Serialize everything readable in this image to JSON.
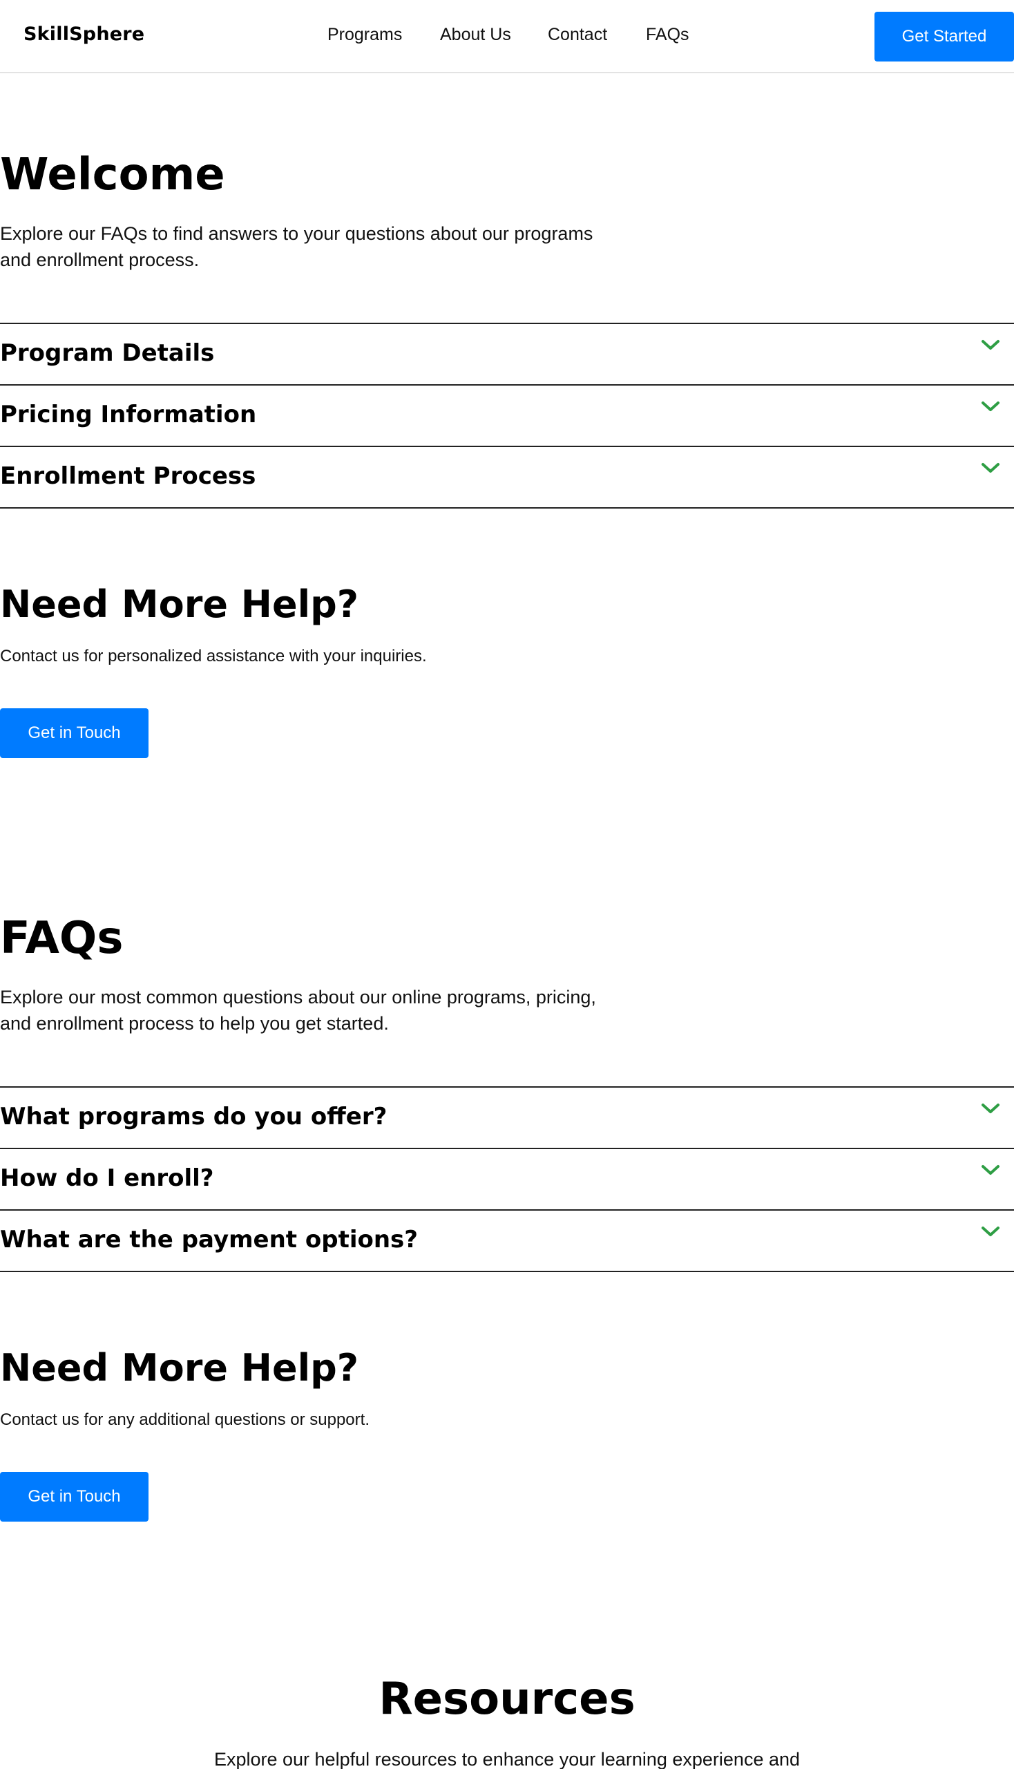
{
  "header": {
    "logo": "SkillSphere",
    "nav": [
      "Programs",
      "About Us",
      "Contact",
      "FAQs"
    ],
    "cta": "Get Started"
  },
  "welcome": {
    "title": "Welcome",
    "description_line1": "Explore our FAQs to find answers to your questions about our programs",
    "description_line2": "and enrollment process."
  },
  "accordion1": {
    "items": [
      "Program Details",
      "Pricing Information",
      "Enrollment Process"
    ],
    "chevron_icon": "chevron-down-icon",
    "chevron_color": "#2e9e44"
  },
  "help1": {
    "title": "Need More Help?",
    "description": "Contact us for personalized assistance with your inquiries.",
    "button": "Get in Touch"
  },
  "faqs": {
    "title": "FAQs",
    "description_line1": "Explore our most common questions about our online programs, pricing,",
    "description_line2": "and enrollment process to help you get started.",
    "items": [
      "What programs do you offer?",
      "How do I enroll?",
      "What are the payment options?"
    ]
  },
  "help2": {
    "title": "Need More Help?",
    "description": "Contact us for any additional questions or support.",
    "button": "Get in Touch"
  },
  "resources": {
    "title": "Resources",
    "description": "Explore our helpful resources to enhance your learning experience and"
  },
  "colors": {
    "accent": "#007bff",
    "chevron": "#2e9e44",
    "divider": "#222222"
  }
}
